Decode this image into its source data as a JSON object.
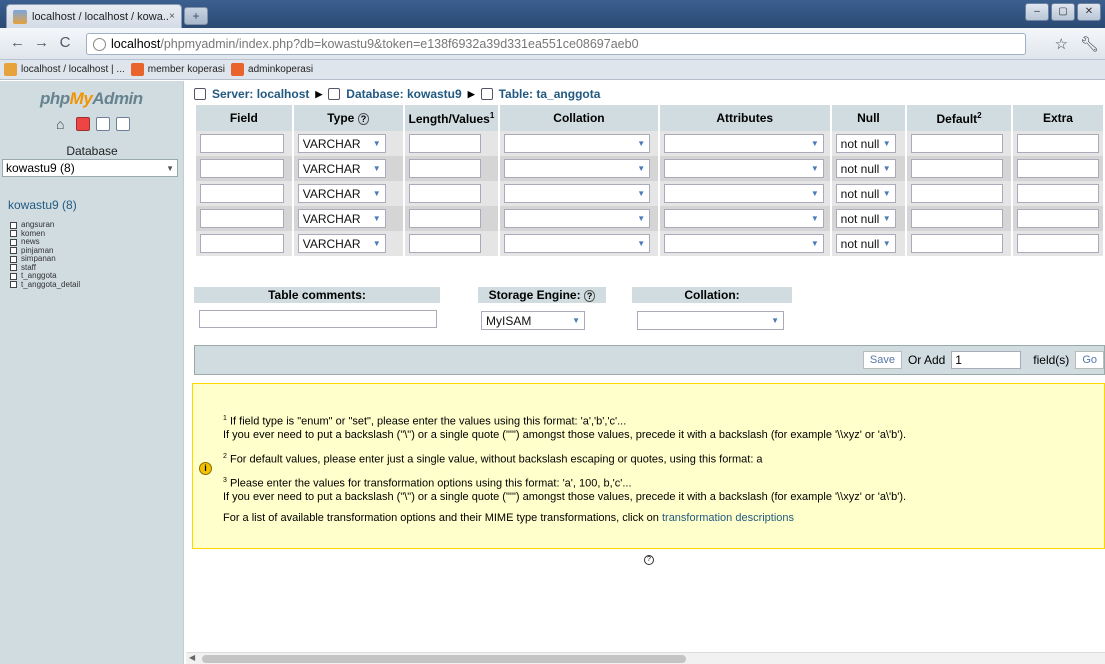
{
  "browser": {
    "tab_title": "localhost / localhost / kowa...",
    "tab_close": "×",
    "new_tab": "+",
    "window_controls": [
      "–",
      "▢",
      "✕"
    ],
    "url_host": "localhost",
    "url_path": "/phpmyadmin/index.php?db=kowastu9&token=e138f6932a39d331ea551ce08697aeb0",
    "bookmarks": [
      {
        "label": "localhost / localhost | ...",
        "color": "#e6a23c"
      },
      {
        "label": "member koperasi",
        "color": "#e8642c"
      },
      {
        "label": "adminkoperasi",
        "color": "#e8642c"
      }
    ]
  },
  "sidebar": {
    "logo_php": "php",
    "logo_my": "My",
    "logo_admin": "Admin",
    "database_label": "Database",
    "database_selected": "kowastu9 (8)",
    "db_title": "kowastu9",
    "db_count": " (8)",
    "tables": [
      "angsuran",
      "komen",
      "news",
      "pinjaman",
      "simpanan",
      "staff",
      "t_anggota",
      "t_anggota_detail"
    ]
  },
  "breadcrumb": {
    "server": "Server: localhost",
    "database": "Database: kowastu9",
    "table": "Table: ta_anggota",
    "sep": "▶"
  },
  "columns": {
    "field": "Field",
    "type": "Type",
    "length": "Length/Values",
    "length_sup": "1",
    "collation": "Collation",
    "attributes": "Attributes",
    "null": "Null",
    "default": "Default",
    "default_sup": "2",
    "extra": "Extra"
  },
  "rows": [
    {
      "type": "VARCHAR",
      "null": "not null"
    },
    {
      "type": "VARCHAR",
      "null": "not null"
    },
    {
      "type": "VARCHAR",
      "null": "not null"
    },
    {
      "type": "VARCHAR",
      "null": "not null"
    },
    {
      "type": "VARCHAR",
      "null": "not null"
    }
  ],
  "table_options": {
    "comments_label": "Table comments:",
    "engine_label": "Storage Engine:",
    "engine_value": "MyISAM",
    "collation_label": "Collation:"
  },
  "savebar": {
    "save": "Save",
    "or_add": "Or Add",
    "add_value": "1",
    "fields": "field(s)",
    "go": "Go"
  },
  "notice": {
    "n1_sup": "1",
    "n1_line1": "If field type is \"enum\" or \"set\", please enter the values using this format: 'a','b','c'...",
    "n1_line2": "If you ever need to put a backslash (\"\\\") or a single quote (\"'\") amongst those values, precede it with a backslash (for example '\\\\xyz' or 'a\\'b').",
    "n2_sup": "2",
    "n2_line1": "For default values, please enter just a single value, without backslash escaping or quotes, using this format: a",
    "n3_sup": "3",
    "n3_line1": "Please enter the values for transformation options using this format: 'a', 100, b,'c'...",
    "n3_line2": "If you ever need to put a backslash (\"\\\") or a single quote (\"'\") amongst those values, precede it with a backslash (for example '\\\\xyz' or 'a\\'b').",
    "n4_text": "For a list of available transformation options and their MIME type transformations, click on ",
    "n4_link": "transformation descriptions"
  }
}
